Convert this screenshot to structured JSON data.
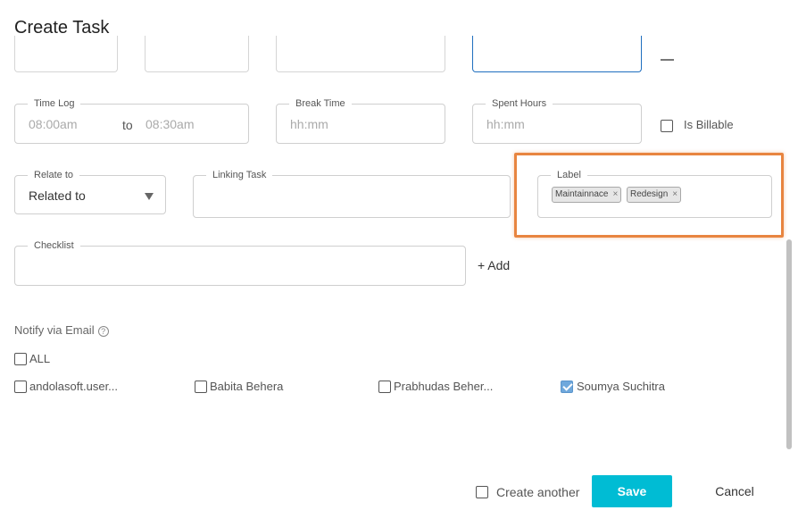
{
  "dialog": {
    "title": "Create Task"
  },
  "time_log": {
    "label": "Time Log",
    "start": "08:00am",
    "separator": "to",
    "end": "08:30am"
  },
  "break_time": {
    "label": "Break Time",
    "placeholder": "hh:mm"
  },
  "spent_hours": {
    "label": "Spent Hours",
    "placeholder": "hh:mm"
  },
  "billable": {
    "label": "Is Billable",
    "checked": false
  },
  "relate_to": {
    "label": "Relate to",
    "value": "Related to"
  },
  "linking_task": {
    "label": "Linking Task",
    "value": ""
  },
  "label_field": {
    "label": "Label",
    "chips": [
      {
        "text": "Maintainnace",
        "remove": "×"
      },
      {
        "text": "Redesign",
        "remove": "×"
      }
    ]
  },
  "checklist": {
    "label": "Checklist",
    "value": "",
    "add_label": "+ Add"
  },
  "notify": {
    "title": "Notify via Email",
    "help_glyph": "?",
    "all_label": "ALL",
    "users": [
      {
        "name": "andolasoft.user...",
        "checked": false
      },
      {
        "name": "Babita Behera",
        "checked": false
      },
      {
        "name": "Prabhudas Beher...",
        "checked": false
      },
      {
        "name": "Soumya Suchitra",
        "checked": true
      }
    ]
  },
  "footer": {
    "create_another_label": "Create another",
    "save_label": "Save",
    "cancel_label": "Cancel"
  },
  "colors": {
    "accent": "#00bcd4",
    "highlight": "#e88540",
    "checked": "#6fa8dc",
    "active_border": "#1f6fbf"
  }
}
